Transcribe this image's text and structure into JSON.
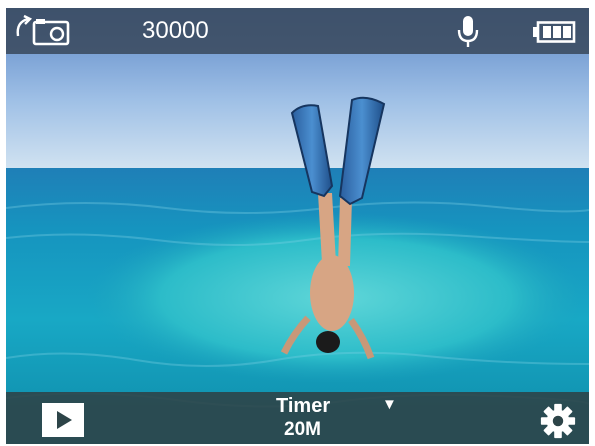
{
  "status_bar": {
    "mode_icon": "timer-photo-icon",
    "shot_count": "30000",
    "mic_icon": "microphone-icon",
    "battery_icon": "battery-icon"
  },
  "controls": {
    "playback_icon": "play-icon",
    "mode": {
      "label": "Timer",
      "caret": "▼",
      "resolution": "20M"
    },
    "settings_icon": "gear-icon"
  },
  "colors": {
    "bar_top": "#3a4a5f",
    "bar_bottom": "#2d4448",
    "text": "#ffffff",
    "sky": "#c6dcef",
    "water": "#1aa6c3",
    "fins": "#2f6fb3"
  }
}
